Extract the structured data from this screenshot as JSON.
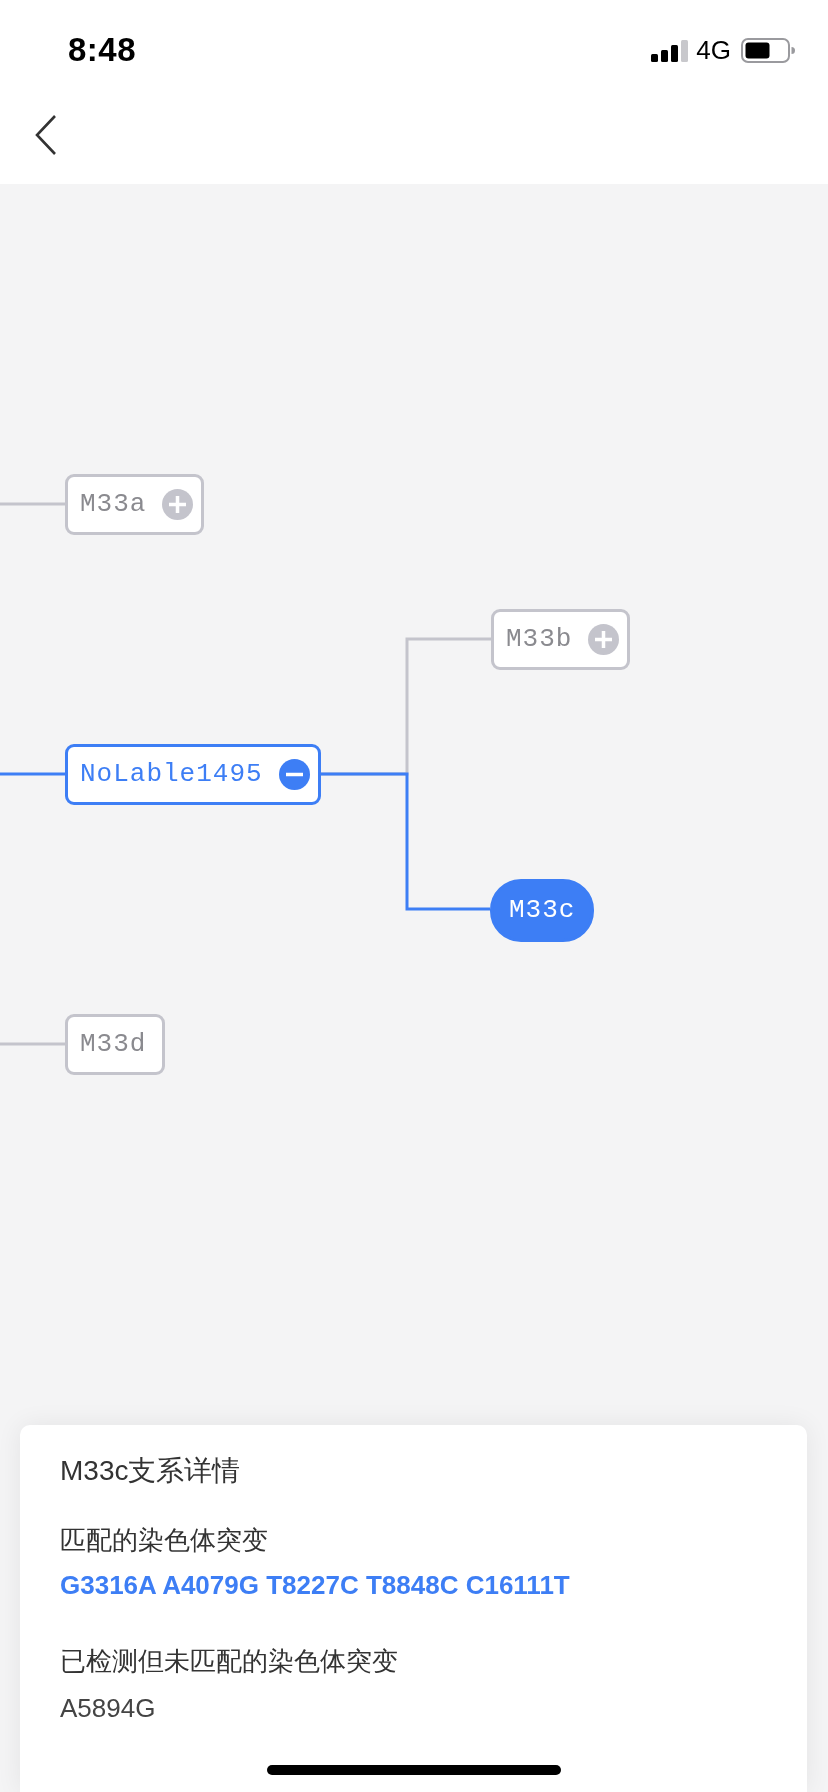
{
  "status_bar": {
    "time": "8:48",
    "network": "4G"
  },
  "tree": {
    "nodes": [
      {
        "label": "M33a",
        "kind": "branch",
        "expanded": false,
        "highlighted": false,
        "selected": false
      },
      {
        "label": "NoLable1495",
        "kind": "branch",
        "expanded": true,
        "highlighted": true,
        "selected": false,
        "children": [
          {
            "label": "M33b",
            "kind": "branch",
            "expanded": false,
            "highlighted": false,
            "selected": false
          },
          {
            "label": "M33c",
            "kind": "leaf",
            "highlighted": false,
            "selected": true
          }
        ]
      },
      {
        "label": "M33d",
        "kind": "leaf",
        "highlighted": false,
        "selected": false
      }
    ]
  },
  "detail_card": {
    "title": "M33c支系详情",
    "sections": [
      {
        "kind": "matched",
        "heading": "匹配的染色体突变",
        "value": "G3316A A4079G T8227C T8848C C16111T"
      },
      {
        "kind": "unmatched",
        "heading": "已检测但未匹配的染色体突变",
        "value": "A5894G"
      }
    ]
  }
}
